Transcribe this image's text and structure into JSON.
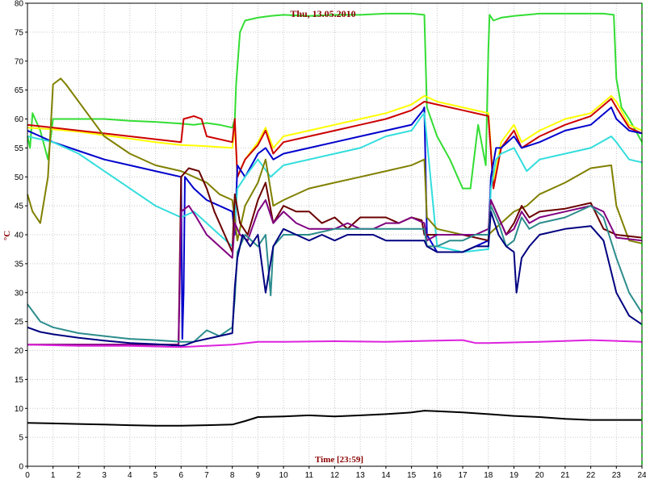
{
  "chart_data": {
    "type": "line",
    "title": "Thu, 13.05.2010",
    "xlabel": "Time [23:59]",
    "ylabel": "°C",
    "xlim": [
      0,
      24
    ],
    "ylim": [
      0,
      80
    ],
    "xticks": [
      0,
      1,
      2,
      3,
      4,
      5,
      6,
      7,
      8,
      9,
      10,
      11,
      12,
      13,
      14,
      15,
      16,
      17,
      18,
      19,
      20,
      21,
      22,
      23,
      24
    ],
    "yticks": [
      0,
      5,
      10,
      15,
      20,
      25,
      30,
      35,
      40,
      45,
      50,
      55,
      60,
      65,
      70,
      75,
      80
    ],
    "grid": true,
    "colors": {
      "grid": "#c8c8c8",
      "axis": "#000000",
      "title": "#8b0000",
      "right_marker": "#00a000"
    },
    "series": [
      {
        "color": "#33dd33",
        "x": [
          0,
          0.1,
          0.2,
          0.5,
          0.8,
          1,
          1.5,
          2,
          3,
          4,
          5,
          6,
          6.5,
          7,
          7.5,
          8,
          8.1,
          8.15,
          8.3,
          8.5,
          9,
          9.5,
          10,
          11,
          12,
          13,
          14,
          15,
          15.5,
          15.6,
          16,
          16.5,
          17,
          17.3,
          17.6,
          17.9,
          18,
          18.05,
          18.2,
          18.5,
          19,
          19.5,
          20,
          21,
          22,
          22.5,
          22.9,
          23,
          23.2,
          23.5,
          24
        ],
        "y": [
          57,
          55,
          61,
          58,
          53,
          60,
          60,
          60,
          60,
          59.7,
          59.5,
          59.2,
          59,
          59.3,
          59,
          58.5,
          60,
          66,
          75,
          77,
          77.5,
          77.8,
          78,
          77.8,
          78,
          78,
          78.2,
          78.2,
          78,
          62,
          57,
          53,
          48,
          48,
          59,
          52,
          72,
          78,
          77,
          77.5,
          77.8,
          78,
          78.2,
          78.2,
          78.2,
          78.2,
          78,
          67,
          62,
          60,
          56
        ]
      },
      {
        "color": "#ffff00",
        "x": [
          0,
          1,
          2,
          3,
          4,
          5,
          6,
          7,
          8,
          8.1,
          8.2,
          8.5,
          9,
          9.3,
          9.6,
          10,
          11,
          12,
          13,
          14,
          15,
          15.5,
          16,
          17,
          18,
          18.2,
          18.5,
          19,
          19.3,
          20,
          21,
          22,
          22.8,
          23,
          23.5,
          24
        ],
        "y": [
          58.5,
          58.2,
          57.8,
          57.2,
          56.6,
          56,
          55.5,
          55.3,
          55,
          59,
          50,
          53,
          56,
          58.5,
          55,
          57,
          58,
          59,
          60,
          61,
          62.5,
          64,
          63,
          62,
          61,
          49,
          56,
          59,
          56,
          58,
          60,
          61,
          64,
          63,
          59,
          58
        ]
      },
      {
        "color": "#cc0000",
        "x": [
          0,
          1,
          2,
          3,
          4,
          5,
          6,
          6.1,
          6.5,
          6.8,
          7,
          8,
          8.1,
          8.2,
          8.5,
          9,
          9.3,
          9.6,
          10,
          11,
          12,
          13,
          14,
          15,
          15.5,
          16,
          17,
          18,
          18.2,
          18.5,
          19,
          19.3,
          20,
          21,
          22,
          22.8,
          23,
          23.5,
          24
        ],
        "y": [
          59,
          58.5,
          58,
          57.5,
          57,
          56.5,
          56,
          60,
          60.5,
          60,
          57,
          56,
          60,
          50,
          53,
          55.5,
          58,
          54,
          56,
          57,
          58,
          59,
          60,
          61.5,
          63,
          62.5,
          61.5,
          60.5,
          48,
          55,
          58,
          55,
          57,
          59,
          60.5,
          63.5,
          62,
          58.5,
          57.5
        ]
      },
      {
        "color": "#0000cc",
        "x": [
          0,
          0.5,
          1,
          2,
          3,
          4,
          5,
          6,
          6.05,
          6.1,
          6.15,
          6.5,
          7,
          8,
          8.1,
          8.2,
          8.5,
          9,
          9.3,
          9.6,
          10,
          11,
          12,
          13,
          14,
          15,
          15.45,
          15.5,
          15.6,
          16,
          17,
          17.5,
          18,
          18.1,
          18.3,
          18.5,
          19,
          19.3,
          20,
          21,
          22,
          22.8,
          23,
          23.5,
          24
        ],
        "y": [
          58,
          57,
          56,
          54.5,
          53,
          52,
          51,
          50,
          22,
          30,
          50,
          48,
          46,
          44,
          40,
          52,
          50,
          54,
          55,
          53,
          54,
          55,
          56,
          57,
          58,
          59,
          61.5,
          62,
          40,
          37,
          37,
          38,
          39,
          50,
          55,
          55,
          57,
          55,
          56,
          58,
          59,
          62,
          60,
          58,
          57.5
        ]
      },
      {
        "color": "#33dddd",
        "x": [
          0,
          1,
          2,
          3,
          4,
          5,
          6,
          6.5,
          7,
          7.5,
          8,
          8.1,
          8.2,
          8.5,
          9,
          9.5,
          10,
          11,
          12,
          13,
          14,
          15,
          15.4,
          15.5,
          16,
          17,
          18,
          18.1,
          18.3,
          18.5,
          19,
          19.5,
          20,
          21,
          22,
          22.8,
          23,
          23.5,
          24
        ],
        "y": [
          57,
          56,
          54,
          51,
          48,
          45,
          43,
          44,
          42,
          40,
          38,
          42,
          48,
          50,
          53,
          50,
          52,
          53,
          54,
          55,
          57,
          58,
          60.5,
          61,
          38,
          37,
          37.5,
          48,
          53,
          54,
          55,
          51,
          53,
          54,
          55,
          57,
          56,
          53,
          52.5
        ]
      },
      {
        "color": "#808000",
        "x": [
          0,
          0.2,
          0.5,
          0.8,
          1,
          1.3,
          1.5,
          2,
          3,
          4,
          5,
          6,
          6.5,
          7,
          7.5,
          8,
          8.2,
          8.5,
          9,
          9.3,
          9.6,
          10,
          11,
          12,
          13,
          14,
          15,
          15.5,
          15.6,
          16,
          17,
          18,
          18.5,
          19,
          19.5,
          20,
          21,
          22,
          22.8,
          23,
          23.5,
          24
        ],
        "y": [
          47,
          44,
          42,
          50,
          66,
          67,
          66,
          63,
          57,
          54,
          52,
          51,
          50,
          49,
          47,
          46,
          39,
          45,
          49,
          53,
          45,
          46,
          48,
          49,
          50,
          51,
          52,
          53,
          43,
          41,
          40,
          40,
          42,
          44,
          45,
          47,
          49,
          51.5,
          52,
          45,
          39,
          38.5
        ]
      },
      {
        "color": "#6b0000",
        "x": [
          0,
          5.9,
          6,
          6.3,
          6.7,
          7,
          7.3,
          7.6,
          8,
          8.1,
          8.3,
          8.6,
          9,
          9.3,
          9.6,
          10,
          10.5,
          11,
          11.5,
          12,
          12.5,
          13,
          13.5,
          14,
          14.5,
          15,
          15.4,
          15.5,
          16,
          17,
          18,
          18.1,
          18.4,
          18.7,
          19,
          19.3,
          19.6,
          20,
          21,
          22,
          22.5,
          23,
          24
        ],
        "y": [
          21,
          21,
          50,
          51.5,
          51,
          48,
          44,
          41,
          37,
          47,
          42,
          40,
          46,
          49,
          42,
          45,
          44,
          44,
          42,
          43,
          41,
          43,
          43,
          43,
          42,
          43,
          42.5,
          40,
          40,
          40,
          39,
          46,
          43,
          40,
          42,
          45,
          43,
          44,
          44.5,
          45.5,
          41,
          40,
          39.5
        ]
      },
      {
        "color": "#800080",
        "x": [
          0,
          5.9,
          6,
          6.3,
          6.6,
          7,
          7.5,
          8,
          8.1,
          8.3,
          8.6,
          9,
          9.3,
          9.6,
          10,
          10.5,
          11,
          11.5,
          12,
          12.5,
          13,
          13.5,
          14,
          14.5,
          15,
          15.5,
          15.6,
          16,
          17,
          17.5,
          18,
          18.1,
          18.4,
          18.7,
          19,
          19.3,
          19.6,
          20,
          21,
          22,
          22.5,
          23,
          24
        ],
        "y": [
          21,
          21,
          44,
          45,
          43,
          40,
          38,
          36,
          42,
          40,
          39,
          44,
          46,
          42,
          44,
          42,
          41,
          41,
          41,
          42,
          41,
          41,
          42,
          42,
          43,
          42,
          39,
          40,
          40,
          40,
          41,
          46,
          43,
          40,
          41,
          44,
          42,
          43,
          44,
          45,
          44,
          39.5,
          39
        ]
      },
      {
        "color": "#2c8c8c",
        "x": [
          0,
          0.5,
          1,
          2,
          3,
          4,
          5,
          6,
          6.5,
          7,
          7.5,
          8,
          8.1,
          8.2,
          8.5,
          9,
          9.3,
          9.5,
          9.6,
          10,
          11,
          12,
          13,
          14,
          15,
          15.5,
          15.6,
          16,
          16.5,
          17,
          17.5,
          18,
          18.1,
          18.4,
          18.7,
          19,
          19.3,
          19.6,
          20,
          21,
          22,
          22.5,
          23,
          23.5,
          24
        ],
        "y": [
          28,
          25,
          24,
          23,
          22.5,
          22,
          21.8,
          21.5,
          21.5,
          23.5,
          22.5,
          24,
          29,
          37,
          40,
          38,
          40,
          29.5,
          38,
          40,
          40,
          41,
          41,
          41,
          41,
          41,
          38,
          38,
          39,
          39,
          40,
          40,
          45,
          42,
          38,
          39,
          43,
          41,
          42,
          43,
          45,
          43,
          36,
          30,
          26.5
        ]
      },
      {
        "color": "#000080",
        "x": [
          0,
          0.5,
          1,
          2,
          3,
          4,
          5,
          6,
          6.2,
          6.5,
          7,
          7.5,
          8,
          8.1,
          8.2,
          8.4,
          8.7,
          9,
          9.3,
          9.6,
          10,
          10.5,
          11,
          11.5,
          12,
          12.5,
          13,
          13.5,
          14,
          14.5,
          15,
          15.5,
          15.6,
          16,
          16.5,
          17,
          17.5,
          18,
          18.1,
          18.4,
          18.7,
          19,
          19.1,
          19.3,
          19.6,
          20,
          21,
          22,
          22.5,
          23,
          23.5,
          24
        ],
        "y": [
          24,
          23.2,
          22.8,
          22.2,
          21.7,
          21.3,
          21.1,
          20.8,
          21,
          21.5,
          22,
          22.5,
          23,
          31,
          36,
          40,
          38,
          40,
          30,
          38,
          41,
          40,
          39,
          40,
          39,
          40,
          40,
          40,
          39,
          39,
          39,
          39,
          38,
          37,
          37,
          37,
          38,
          38,
          44,
          40,
          38,
          37,
          30,
          36,
          38,
          40,
          41,
          41.5,
          39,
          30,
          26,
          24.5
        ]
      },
      {
        "color": "#dd22dd",
        "x": [
          0,
          2,
          4,
          6,
          8,
          9,
          10,
          12,
          14,
          16,
          17,
          17.5,
          18,
          20,
          22,
          24
        ],
        "y": [
          21,
          20.8,
          20.8,
          20.6,
          21,
          21.5,
          21.5,
          21.6,
          21.5,
          21.7,
          21.8,
          21.3,
          21.3,
          21.5,
          21.8,
          21.5
        ]
      },
      {
        "color": "#000000",
        "x": [
          0,
          1,
          2,
          3,
          4,
          5,
          6,
          7,
          8,
          8.5,
          9,
          10,
          11,
          12,
          13,
          14,
          15,
          15.5,
          16,
          17,
          18,
          19,
          20,
          21,
          22,
          23,
          24
        ],
        "y": [
          7.5,
          7.4,
          7.3,
          7.2,
          7.1,
          7,
          7,
          7.1,
          7.2,
          7.8,
          8.5,
          8.6,
          8.8,
          8.6,
          8.8,
          9,
          9.3,
          9.6,
          9.5,
          9.3,
          9,
          8.7,
          8.5,
          8.2,
          8,
          8,
          8
        ]
      }
    ]
  }
}
